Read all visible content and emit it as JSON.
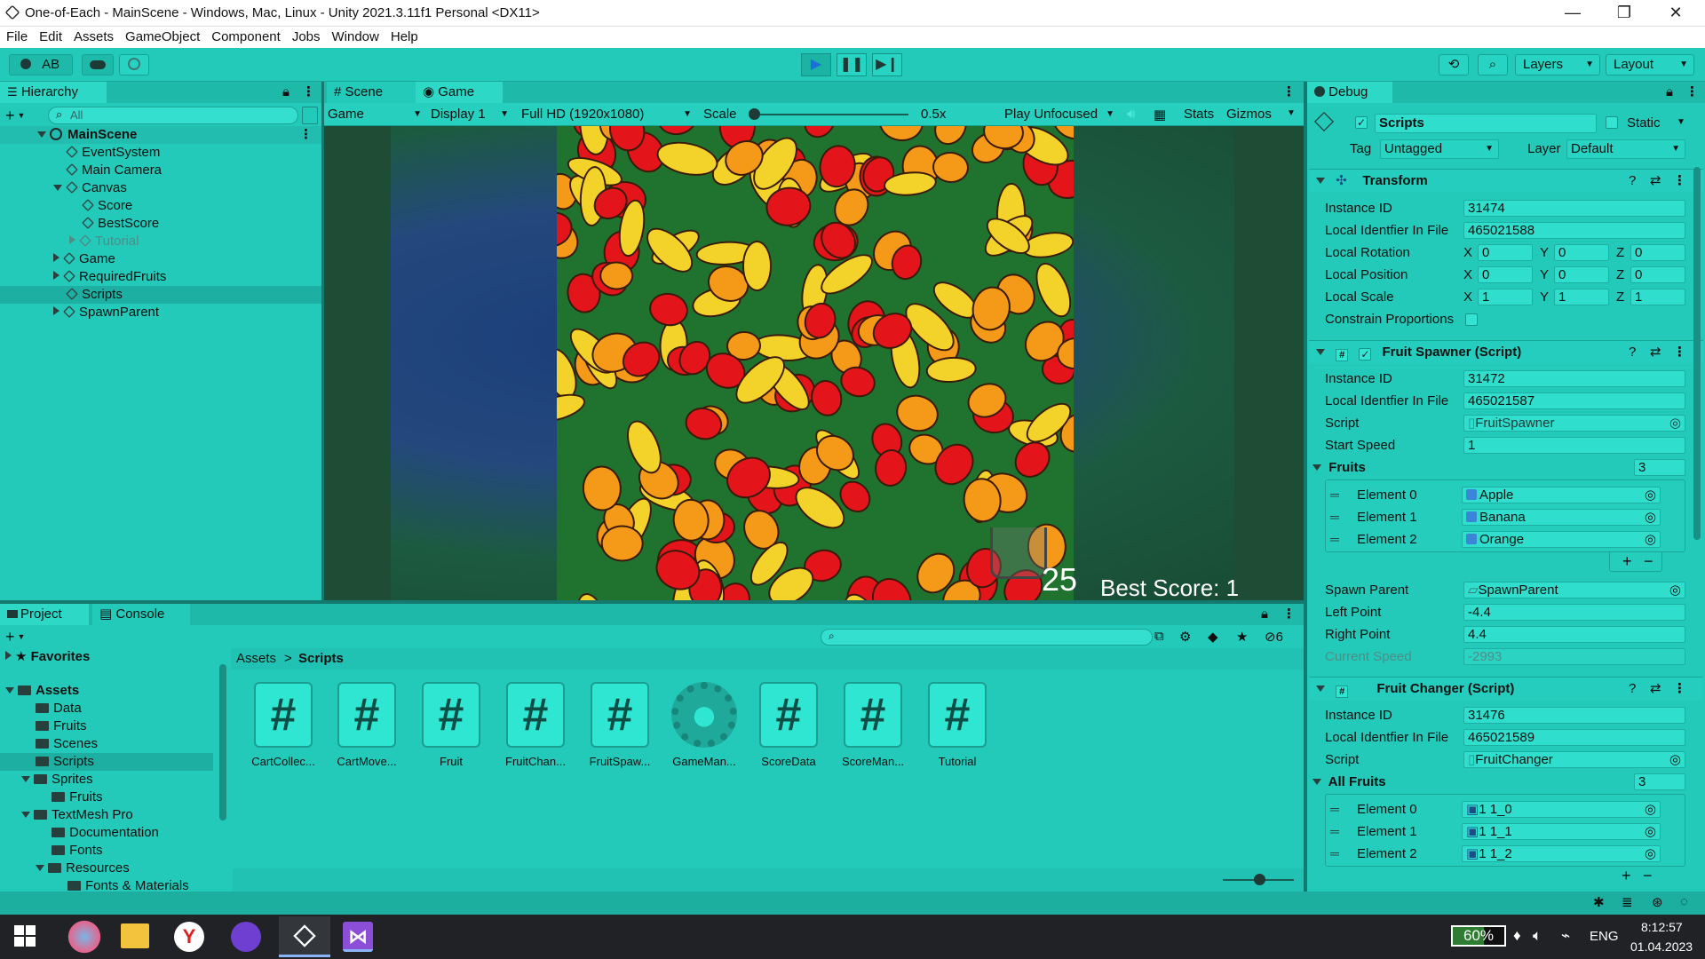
{
  "window": {
    "title": "One-of-Each - MainScene - Windows, Mac, Linux - Unity 2021.3.11f1 Personal <DX11>"
  },
  "menu": [
    "File",
    "Edit",
    "Assets",
    "GameObject",
    "Component",
    "Jobs",
    "Window",
    "Help"
  ],
  "toolbar": {
    "account": "AB",
    "layers": "Layers",
    "layout": "Layout"
  },
  "hierarchy": {
    "tab": "Hierarchy",
    "search_placeholder": "All",
    "scene": "MainScene",
    "items": [
      {
        "label": "EventSystem"
      },
      {
        "label": "Main Camera"
      },
      {
        "label": "Canvas"
      },
      {
        "label": "Score"
      },
      {
        "label": "BestScore"
      },
      {
        "label": "Tutorial"
      },
      {
        "label": "Game"
      },
      {
        "label": "RequiredFruits"
      },
      {
        "label": "Scripts"
      },
      {
        "label": "SpawnParent"
      }
    ]
  },
  "gameview": {
    "tabs": {
      "scene": "Scene",
      "game": "Game"
    },
    "game_dropdown": "Game",
    "display": "Display 1",
    "resolution": "Full HD (1920x1080)",
    "scale_label": "Scale",
    "scale_value": "0.5x",
    "play_mode": "Play Unfocused",
    "stats": "Stats",
    "gizmos": "Gizmos",
    "score": "25",
    "best_score": "Best Score: 1"
  },
  "inspector": {
    "tab": "Debug",
    "object_name": "Scripts",
    "static_label": "Static",
    "tag_label": "Tag",
    "tag_value": "Untagged",
    "layer_label": "Layer",
    "layer_value": "Default",
    "transform": {
      "title": "Transform",
      "instance_id_label": "Instance ID",
      "instance_id": "31474",
      "local_id_label": "Local Identfier In File",
      "local_id": "465021588",
      "rotation_label": "Local Rotation",
      "position_label": "Local Position",
      "scale_label": "Local Scale",
      "x": "X",
      "y": "Y",
      "z": "Z",
      "rotation": [
        "0",
        "0",
        "0"
      ],
      "position": [
        "0",
        "0",
        "0"
      ],
      "scale": [
        "1",
        "1",
        "1"
      ],
      "constrain_label": "Constrain Proportions"
    },
    "fruit_spawner": {
      "title": "Fruit Spawner (Script)",
      "instance_id_label": "Instance ID",
      "instance_id": "31472",
      "local_id_label": "Local Identfier In File",
      "local_id": "465021587",
      "script_label": "Script",
      "script": "FruitSpawner",
      "start_speed_label": "Start Speed",
      "start_speed": "1",
      "fruits_label": "Fruits",
      "fruits_count": "3",
      "elements": [
        {
          "label": "Element 0",
          "value": "Apple"
        },
        {
          "label": "Element 1",
          "value": "Banana"
        },
        {
          "label": "Element 2",
          "value": "Orange"
        }
      ],
      "spawn_parent_label": "Spawn Parent",
      "spawn_parent": "SpawnParent",
      "left_point_label": "Left Point",
      "left_point": "-4.4",
      "right_point_label": "Right Point",
      "right_point": "4.4",
      "current_speed_label": "Current Speed",
      "current_speed": "-2993"
    },
    "fruit_changer": {
      "title": "Fruit Changer (Script)",
      "instance_id_label": "Instance ID",
      "instance_id": "31476",
      "local_id_label": "Local Identfier In File",
      "local_id": "465021589",
      "script_label": "Script",
      "script": "FruitChanger",
      "all_fruits_label": "All Fruits",
      "all_fruits_count": "3",
      "elements": [
        {
          "label": "Element 0",
          "value": "1 1_0"
        },
        {
          "label": "Element 1",
          "value": "1 1_1"
        },
        {
          "label": "Element 2",
          "value": "1 1_2"
        }
      ]
    }
  },
  "project": {
    "tabs": {
      "project": "Project",
      "console": "Console"
    },
    "hidden_count": "6",
    "favorites": "Favorites",
    "tree": [
      {
        "label": "Assets"
      },
      {
        "label": "Data"
      },
      {
        "label": "Fruits"
      },
      {
        "label": "Scenes"
      },
      {
        "label": "Scripts"
      },
      {
        "label": "Sprites"
      },
      {
        "label": "Fruits"
      },
      {
        "label": "TextMesh Pro"
      },
      {
        "label": "Documentation"
      },
      {
        "label": "Fonts"
      },
      {
        "label": "Resources"
      },
      {
        "label": "Fonts & Materials"
      }
    ],
    "breadcrumb": {
      "root": "Assets",
      "sep": ">",
      "current": "Scripts"
    },
    "assets": [
      {
        "label": "CartCollec..."
      },
      {
        "label": "CartMove..."
      },
      {
        "label": "Fruit"
      },
      {
        "label": "FruitChan..."
      },
      {
        "label": "FruitSpaw..."
      },
      {
        "label": "GameMan..."
      },
      {
        "label": "ScoreData"
      },
      {
        "label": "ScoreMan..."
      },
      {
        "label": "Tutorial"
      }
    ]
  },
  "taskbar": {
    "battery": "60%",
    "lang": "ENG",
    "time": "8:12:57",
    "date": "01.04.2023"
  },
  "colors": {
    "editor_bg": "#23c9b9",
    "apple": "#e3151b",
    "banana": "#f3d32a",
    "orange": "#f59a18",
    "play_icon": "#1a6fd8"
  }
}
